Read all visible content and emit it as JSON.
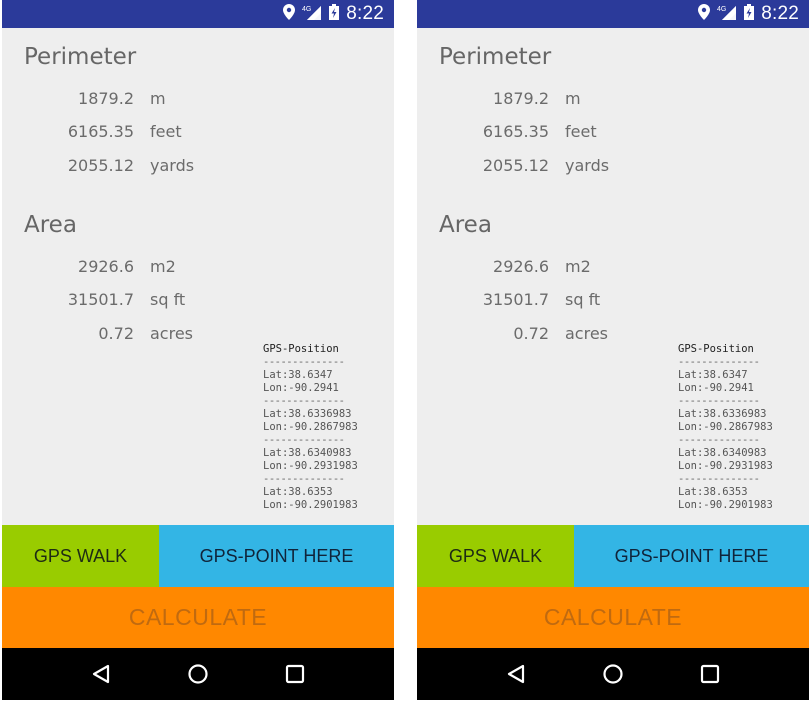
{
  "colors": {
    "status_bar": "#2b3a9a",
    "background": "#eeeeee",
    "gps_walk_button": "#99cc00",
    "gps_point_button": "#33b5e5",
    "calculate_button": "#ff8800",
    "nav_bar": "#000000"
  },
  "screens": [
    {
      "status_bar": {
        "icons": [
          "location-icon",
          "4g-signal-icon",
          "battery-charging-icon"
        ],
        "network_label": "4G",
        "time": "8:22"
      },
      "perimeter": {
        "title": "Perimeter",
        "rows": [
          {
            "value": "1879.2",
            "unit": "m"
          },
          {
            "value": "6165.35",
            "unit": "feet"
          },
          {
            "value": "2055.12",
            "unit": "yards"
          }
        ]
      },
      "area": {
        "title": "Area",
        "rows": [
          {
            "value": "2926.6",
            "unit": "m2"
          },
          {
            "value": "31501.7",
            "unit": "sq ft"
          },
          {
            "value": "0.72",
            "unit": "acres"
          }
        ]
      },
      "gps_position": {
        "title": "GPS-Position",
        "separator": "--------------",
        "points": [
          {
            "lat": "Lat:38.6347",
            "lon": "Lon:-90.2941"
          },
          {
            "lat": "Lat:38.6336983",
            "lon": "Lon:-90.2867983"
          },
          {
            "lat": "Lat:38.6340983",
            "lon": "Lon:-90.2931983"
          },
          {
            "lat": "Lat:38.6353",
            "lon": "Lon:-90.2901983"
          }
        ]
      },
      "buttons": {
        "gps_walk": "GPS WALK",
        "gps_point_here": "GPS-POINT HERE",
        "calculate": "CALCULATE"
      },
      "nav_bar": {
        "icons": [
          "back-icon",
          "home-icon",
          "recents-icon"
        ]
      }
    },
    {
      "status_bar": {
        "icons": [
          "location-icon",
          "4g-signal-icon",
          "battery-charging-icon"
        ],
        "network_label": "4G",
        "time": "8:22"
      },
      "perimeter": {
        "title": "Perimeter",
        "rows": [
          {
            "value": "1879.2",
            "unit": "m"
          },
          {
            "value": "6165.35",
            "unit": "feet"
          },
          {
            "value": "2055.12",
            "unit": "yards"
          }
        ]
      },
      "area": {
        "title": "Area",
        "rows": [
          {
            "value": "2926.6",
            "unit": "m2"
          },
          {
            "value": "31501.7",
            "unit": "sq ft"
          },
          {
            "value": "0.72",
            "unit": "acres"
          }
        ]
      },
      "gps_position": {
        "title": "GPS-Position",
        "separator": "--------------",
        "points": [
          {
            "lat": "Lat:38.6347",
            "lon": "Lon:-90.2941"
          },
          {
            "lat": "Lat:38.6336983",
            "lon": "Lon:-90.2867983"
          },
          {
            "lat": "Lat:38.6340983",
            "lon": "Lon:-90.2931983"
          },
          {
            "lat": "Lat:38.6353",
            "lon": "Lon:-90.2901983"
          }
        ]
      },
      "buttons": {
        "gps_walk": "GPS WALK",
        "gps_point_here": "GPS-POINT HERE",
        "calculate": "CALCULATE"
      },
      "nav_bar": {
        "icons": [
          "back-icon",
          "home-icon",
          "recents-icon"
        ]
      }
    }
  ]
}
